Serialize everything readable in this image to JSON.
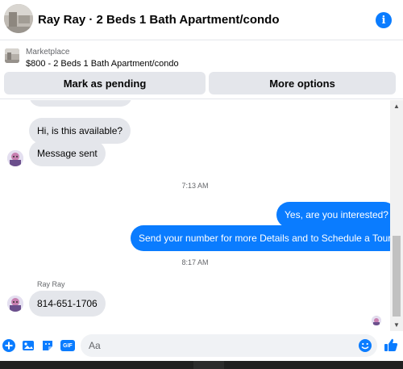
{
  "header": {
    "title": "Ray Ray · 2 Beds 1 Bath Apartment/condo",
    "info_label": "i"
  },
  "marketplace": {
    "source": "Marketplace",
    "listing": "$800 - 2 Beds 1 Bath Apartment/condo",
    "pending_label": "Mark as pending",
    "more_label": "More options"
  },
  "messages": {
    "incoming_1": "Hi, is this available?",
    "incoming_2": "Message sent",
    "timestamp_1": "7:13 AM",
    "outgoing_1": "Yes, are you interested?",
    "outgoing_2": "Send your number for more Details and to Schedule a Tour.",
    "timestamp_2": "8:17 AM",
    "sender_name": "Ray Ray",
    "incoming_3": "814-651-1706"
  },
  "composer": {
    "placeholder": "Aa",
    "gif_label": "GIF"
  },
  "colors": {
    "accent": "#0a7cff",
    "incoming_bubble": "#e4e6eb",
    "like": "#0a7cff"
  },
  "icons": [
    "info-icon",
    "scroll-up-arrow-icon",
    "scroll-down-arrow-icon",
    "plus-icon",
    "image-icon",
    "sticker-icon",
    "gif-icon",
    "emoji-icon",
    "thumbs-up-icon"
  ]
}
